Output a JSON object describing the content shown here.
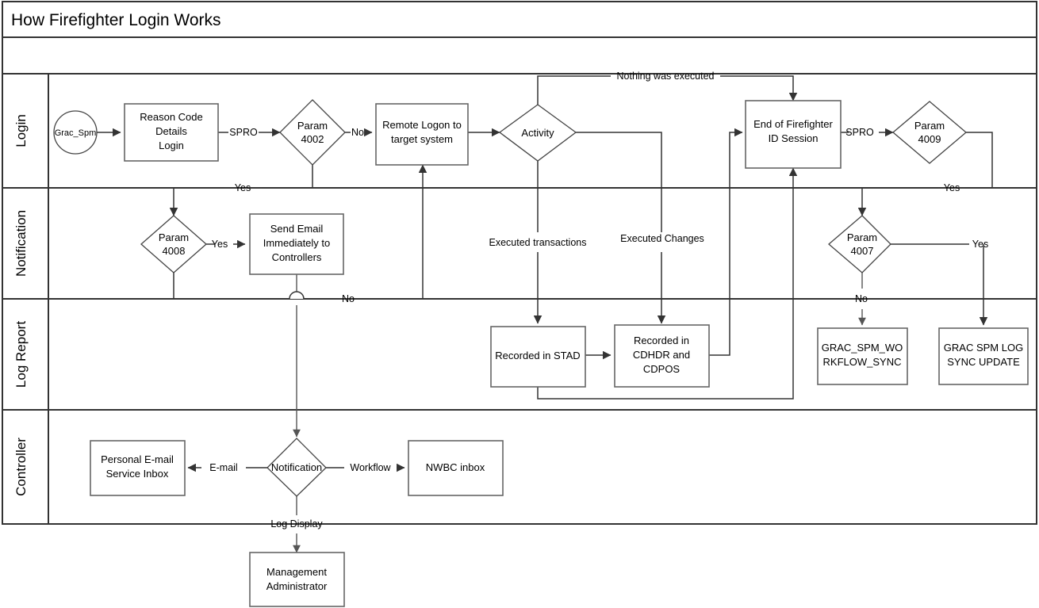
{
  "title": "How Firefighter Login Works",
  "lanes": [
    {
      "id": "login",
      "label": "Login"
    },
    {
      "id": "notification",
      "label": "Notification"
    },
    {
      "id": "logreport",
      "label": "Log Report"
    },
    {
      "id": "controller",
      "label": "Controller"
    }
  ],
  "nodes": {
    "grac_spm": {
      "label": "Grac_Spm",
      "shape": "circle"
    },
    "reason_code": {
      "line1": "Reason Code",
      "line2": "Details",
      "line3": "Login",
      "shape": "box"
    },
    "param4002": {
      "line1": "Param",
      "line2": "4002",
      "shape": "diamond"
    },
    "remote_logon": {
      "line1": "Remote Logon to",
      "line2": "target system",
      "shape": "box"
    },
    "activity": {
      "label": "Activity",
      "shape": "diamond"
    },
    "end_of_ff": {
      "line1": "End of Firefighter",
      "line2": "ID Session",
      "shape": "box"
    },
    "param4009": {
      "line1": "Param",
      "line2": "4009",
      "shape": "diamond"
    },
    "param4008": {
      "line1": "Param",
      "line2": "4008",
      "shape": "diamond"
    },
    "send_email": {
      "line1": "Send Email",
      "line2": "Immediately to",
      "line3": "Controllers",
      "shape": "box"
    },
    "param4007": {
      "line1": "Param",
      "line2": "4007",
      "shape": "diamond"
    },
    "recorded_stad": {
      "line1": "Recorded in STAD",
      "shape": "box"
    },
    "recorded_cdhdr": {
      "line1": "Recorded in",
      "line2": "CDHDR and",
      "line3": "CDPOS",
      "shape": "box"
    },
    "grac_wf_sync": {
      "line1": "GRAC_SPM_WO",
      "line2": "RKFLOW_SYNC",
      "shape": "box"
    },
    "grac_log_sync": {
      "line1": "GRAC SPM LOG",
      "line2": "SYNC UPDATE",
      "shape": "box"
    },
    "personal_email": {
      "line1": "Personal E-mail",
      "line2": "Service Inbox",
      "shape": "box"
    },
    "notification_d": {
      "label": "Notification",
      "shape": "diamond"
    },
    "nwbc_inbox": {
      "label": "NWBC inbox",
      "shape": "box"
    },
    "mgmt_admin": {
      "line1": "Management",
      "line2": "Administrator",
      "shape": "box"
    }
  },
  "edge_labels": {
    "spro_1": "SPRO",
    "no_4002": "No",
    "yes_4002": "Yes",
    "nothing_executed": "Nothing was executed",
    "executed_transactions": "Executed transactions",
    "executed_changes": "Executed Changes",
    "spro_2": "SPRO",
    "yes_4009": "Yes",
    "yes_4008": "Yes",
    "no_4008": "No",
    "yes_4007": "Yes",
    "no_4007": "No",
    "email": "E-mail",
    "workflow": "Workflow",
    "log_display": "Log Display"
  },
  "colors": {
    "frame": "#333333",
    "node_stroke": "#666666",
    "edge": "#333333",
    "background": "#ffffff",
    "text": "#000000"
  }
}
